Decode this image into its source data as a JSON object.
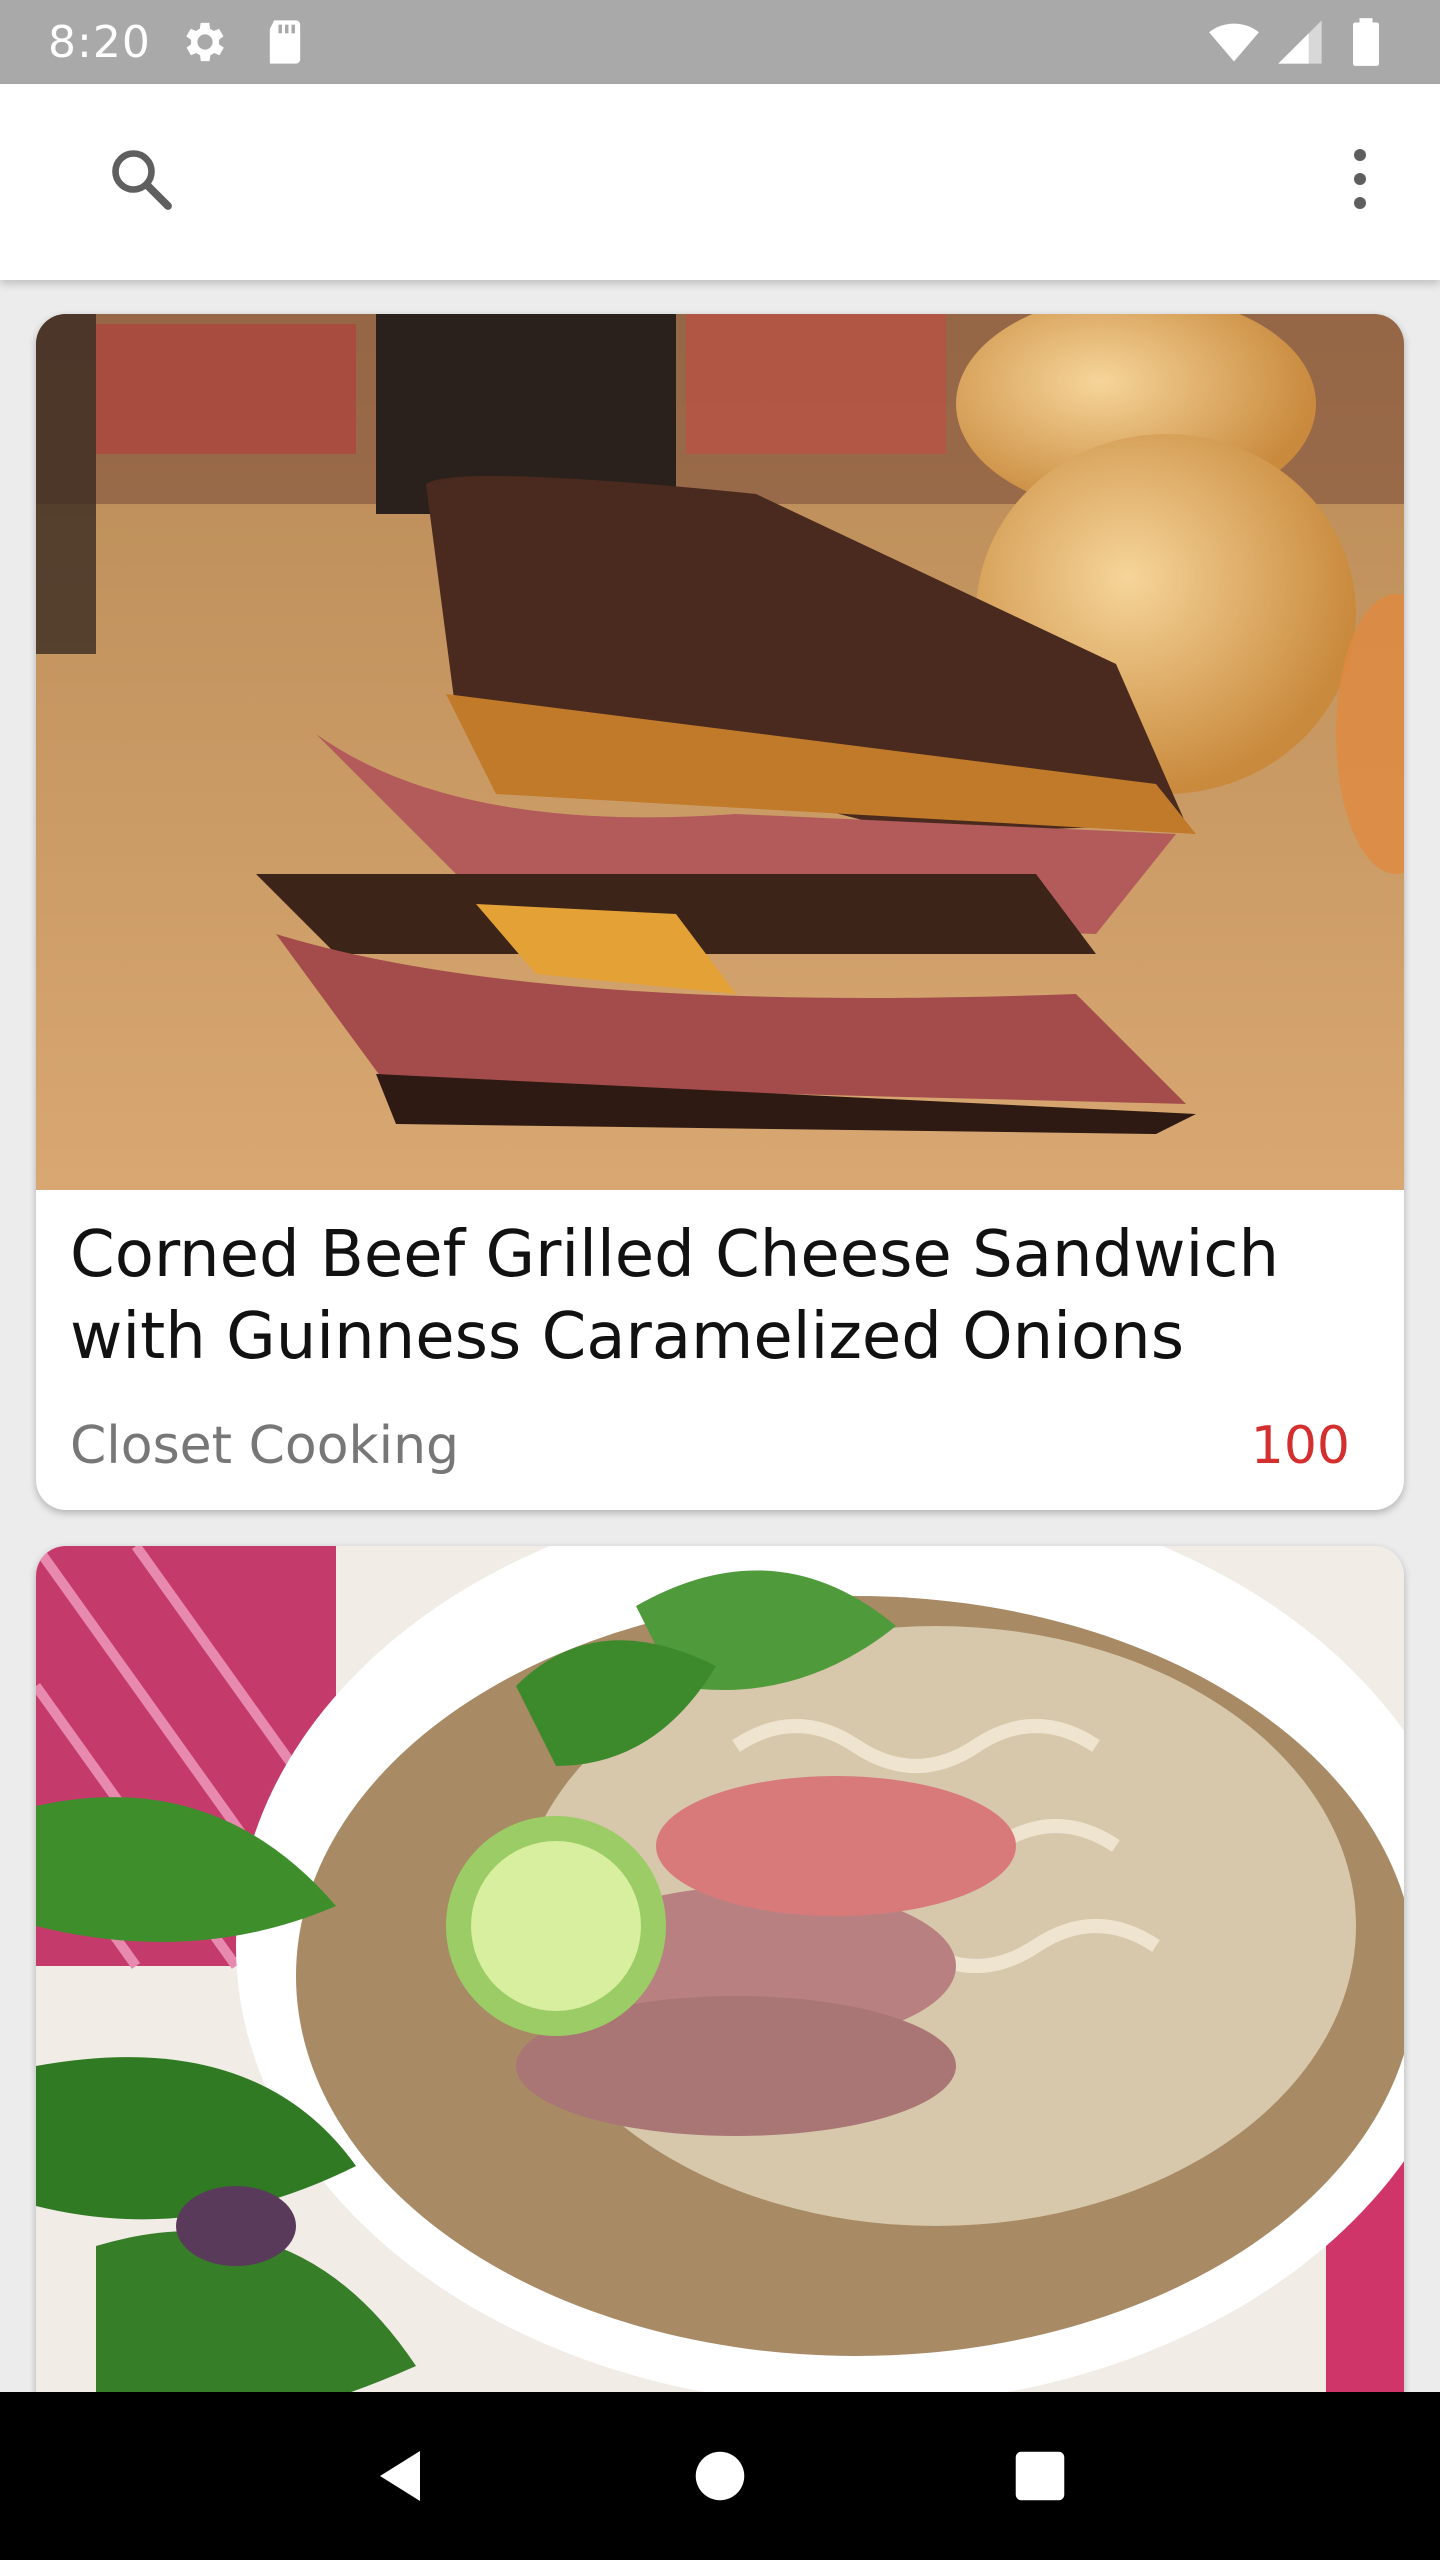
{
  "status_bar": {
    "time": "8:20",
    "icons": [
      "gear-icon",
      "sd-card-icon",
      "wifi-icon",
      "signal-icon",
      "battery-icon"
    ]
  },
  "app_bar": {
    "search_icon": "search-icon",
    "menu_icon": "more-vert-icon"
  },
  "recipes": [
    {
      "title": "Corned Beef Grilled Cheese Sandwich with Guinness Caramelized Onions",
      "publisher": "Closet Cooking",
      "social_rank": "100",
      "image": "grilled-sandwich-photo"
    },
    {
      "title": "",
      "publisher": "",
      "social_rank": "",
      "image": "pho-noodle-soup-photo"
    }
  ],
  "nav_bar": {
    "buttons": [
      "back-icon",
      "home-icon",
      "recents-icon"
    ]
  },
  "colors": {
    "status_bar": "#a9a9a9",
    "app_bar": "#ffffff",
    "background": "#ececec",
    "rank": "#d32f2f",
    "publisher": "#777777"
  }
}
